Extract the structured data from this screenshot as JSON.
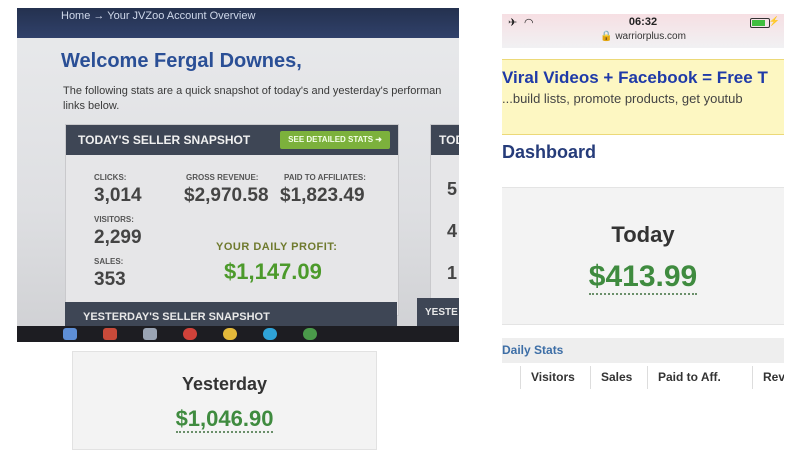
{
  "jvzoo": {
    "breadcrumb": "Home → Your JVZoo Account Overview",
    "welcome": "Welcome Fergal Downes,",
    "intro": "The following stats are a quick snapshot of today's and yesterday's performan links below.",
    "today_snapshot": {
      "title": "TODAY'S SELLER SNAPSHOT",
      "details_button": "SEE DETAILED STATS ➜",
      "clicks_label": "CLICKS:",
      "clicks": "3,014",
      "visitors_label": "VISITORS:",
      "visitors": "2,299",
      "sales_label": "SALES:",
      "sales": "353",
      "gross_label": "GROSS REVENUE:",
      "gross": "$2,970.58",
      "affiliates_label": "PAID TO AFFILIATES:",
      "affiliates": "$1,823.49",
      "profit_label": "YOUR DAILY PROFIT:",
      "profit": "$1,147.09"
    },
    "second_card": {
      "title": "TOD",
      "v1": "5",
      "v2": "4",
      "v3": "1"
    },
    "yesterday_snapshot": {
      "title": "YESTERDAY'S SELLER SNAPSHOT",
      "title2": "YESTE"
    }
  },
  "yesterday_card": {
    "title": "Yesterday",
    "value": "$1,046.90"
  },
  "mobile": {
    "time": "06:32",
    "url": "🔒 warriorplus.com",
    "banner_headline": "Viral Videos + Facebook = Free T",
    "banner_sub": "...build lists, promote products, get youtub",
    "dashboard": "Dashboard",
    "today_title": "Today",
    "today_value": "$413.99",
    "daily_stats": "Daily Stats",
    "columns": [
      "Visitors",
      "Sales",
      "Paid to Aff.",
      "Rev"
    ]
  },
  "colors": {
    "profit_green": "#3f8b3f",
    "link_blue": "#1f3aa8",
    "jv_header": "#3e4655"
  }
}
